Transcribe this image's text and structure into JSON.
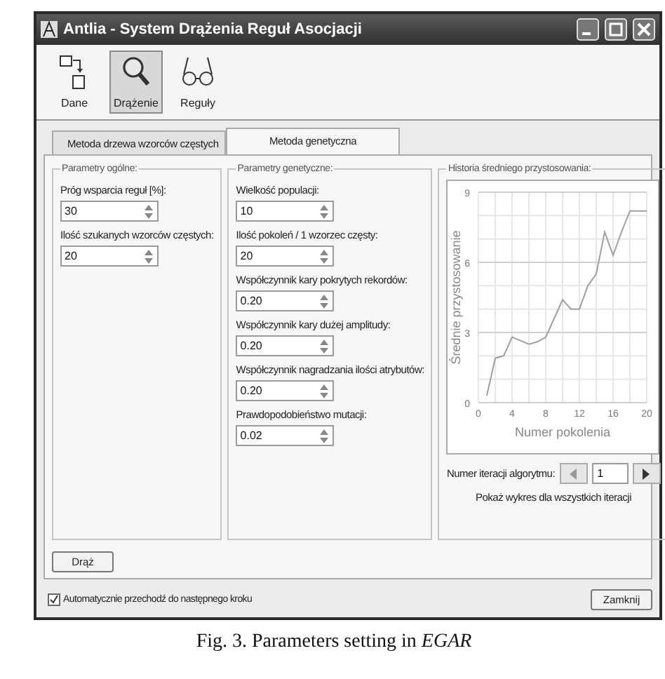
{
  "window": {
    "title": "Antlia - System Drążenia Reguł Asocjacji"
  },
  "toolbar": [
    {
      "label": "Dane",
      "kind": "data",
      "selected": false
    },
    {
      "label": "Drążenie",
      "kind": "search",
      "selected": true
    },
    {
      "label": "Reguły",
      "kind": "glasses",
      "selected": false
    }
  ],
  "tabs": [
    {
      "label": "Metoda drzewa wzorców częstych",
      "selected": false
    },
    {
      "label": "Metoda genetyczna",
      "selected": true
    }
  ],
  "general": {
    "title": "Parametry ogólne:",
    "fields": [
      {
        "label": "Próg wsparcia reguł [%]:",
        "value": "30"
      },
      {
        "label": "Ilość szukanych wzorców częstych:",
        "value": "20"
      }
    ]
  },
  "genetic": {
    "title": "Parametry genetyczne:",
    "fields": [
      {
        "label": "Wielkość populacji:",
        "value": "10"
      },
      {
        "label": "Ilość pokoleń / 1 wzorzec częsty:",
        "value": "20"
      },
      {
        "label": "Współczynnik kary pokrytych rekordów:",
        "value": "0.20"
      },
      {
        "label": "Współczynnik kary dużej amplitudy:",
        "value": "0.20"
      },
      {
        "label": "Współczynnik nagradzania ilości atrybutów:",
        "value": "0.20"
      },
      {
        "label": "Prawdopodobieństwo mutacji:",
        "value": "0.02"
      }
    ]
  },
  "history": {
    "title": "Historia średniego przystosowania:",
    "chart_data": {
      "type": "line",
      "xlabel": "Numer pokolenia",
      "ylabel": "Średnie przystosowanie",
      "x": [
        1,
        2,
        3,
        4,
        5,
        6,
        7,
        8,
        9,
        10,
        11,
        12,
        13,
        14,
        15,
        16,
        17,
        18,
        19,
        20
      ],
      "grid": true,
      "series": [
        {
          "color": "#a0a0a0",
          "values": [
            0.3,
            1.9,
            2.0,
            2.8,
            2.65,
            2.5,
            2.6,
            2.8,
            3.6,
            4.4,
            4.0,
            4.0,
            5.0,
            5.5,
            7.3,
            6.3,
            7.3,
            8.2,
            8.2,
            8.2
          ]
        }
      ],
      "xlim": [
        0,
        20
      ],
      "ylim": [
        0,
        9
      ],
      "xticks": [
        0,
        4,
        8,
        12,
        16,
        20
      ],
      "yticks": [
        0,
        3,
        6,
        9
      ]
    },
    "iteration_label": "Numer iteracji algorytmu:",
    "iteration_value": "1",
    "show_all": "Pokaż wykres dla wszystkich iteracji"
  },
  "mine_button": "Drąż",
  "auto_next": {
    "label": "Automatycznie przechodź do następnego kroku",
    "checked": true
  },
  "close_button": "Zamknij",
  "caption": "Fig. 3. Parameters setting in *EGAR*"
}
